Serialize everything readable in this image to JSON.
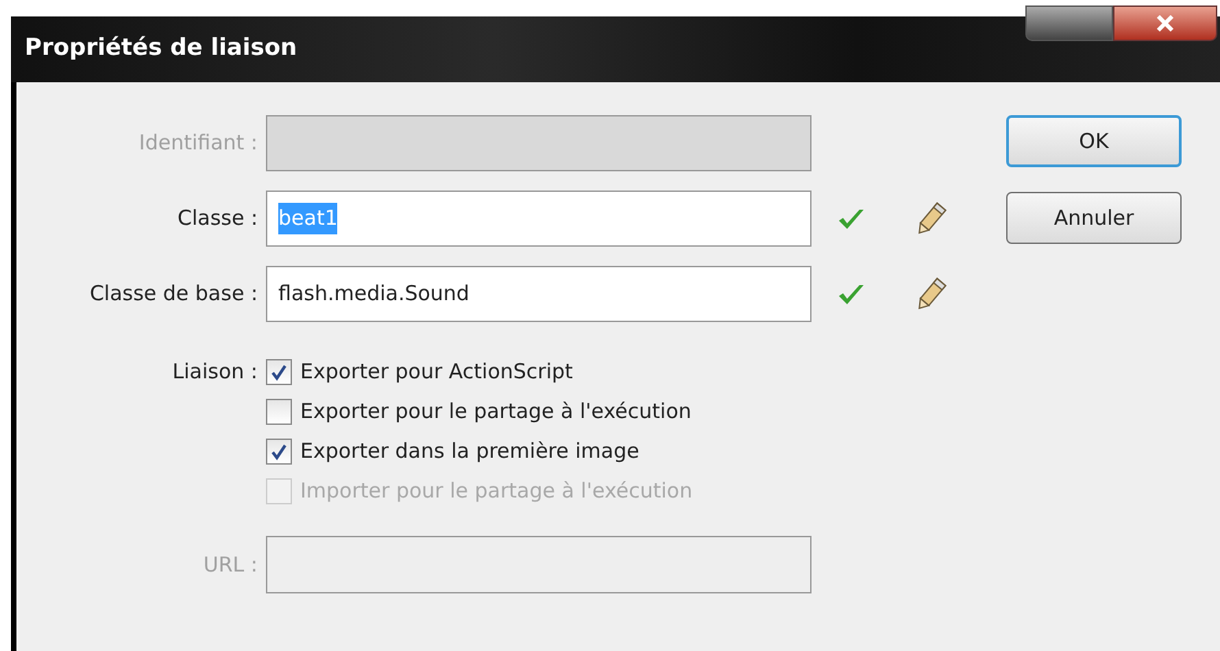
{
  "window": {
    "title": "Propriétés de liaison"
  },
  "fields": [
    {
      "label": "Identifiant :",
      "disabled": true
    },
    {
      "label": "Classe :",
      "value": "beat1",
      "disabled": false,
      "highlighted": true,
      "tools": true
    },
    {
      "label": "Classe de base :",
      "value": "flash.media.Sound",
      "disabled": false,
      "tools": true
    }
  ],
  "linkage": {
    "label": "Liaison :",
    "options": [
      {
        "label": "Exporter pour ActionScript",
        "checked": true,
        "disabled": false
      },
      {
        "label": "Exporter pour le partage à l'exécution",
        "checked": false,
        "disabled": false
      },
      {
        "label": "Exporter dans la première image",
        "checked": true,
        "disabled": false
      },
      {
        "label": "Importer pour le partage à l'exécution",
        "checked": false,
        "disabled": true
      }
    ]
  },
  "url": {
    "label": "URL :",
    "disabled": true
  },
  "buttons": [
    {
      "label": "OK",
      "default": true
    },
    {
      "label": "Annuler",
      "default": false
    }
  ]
}
